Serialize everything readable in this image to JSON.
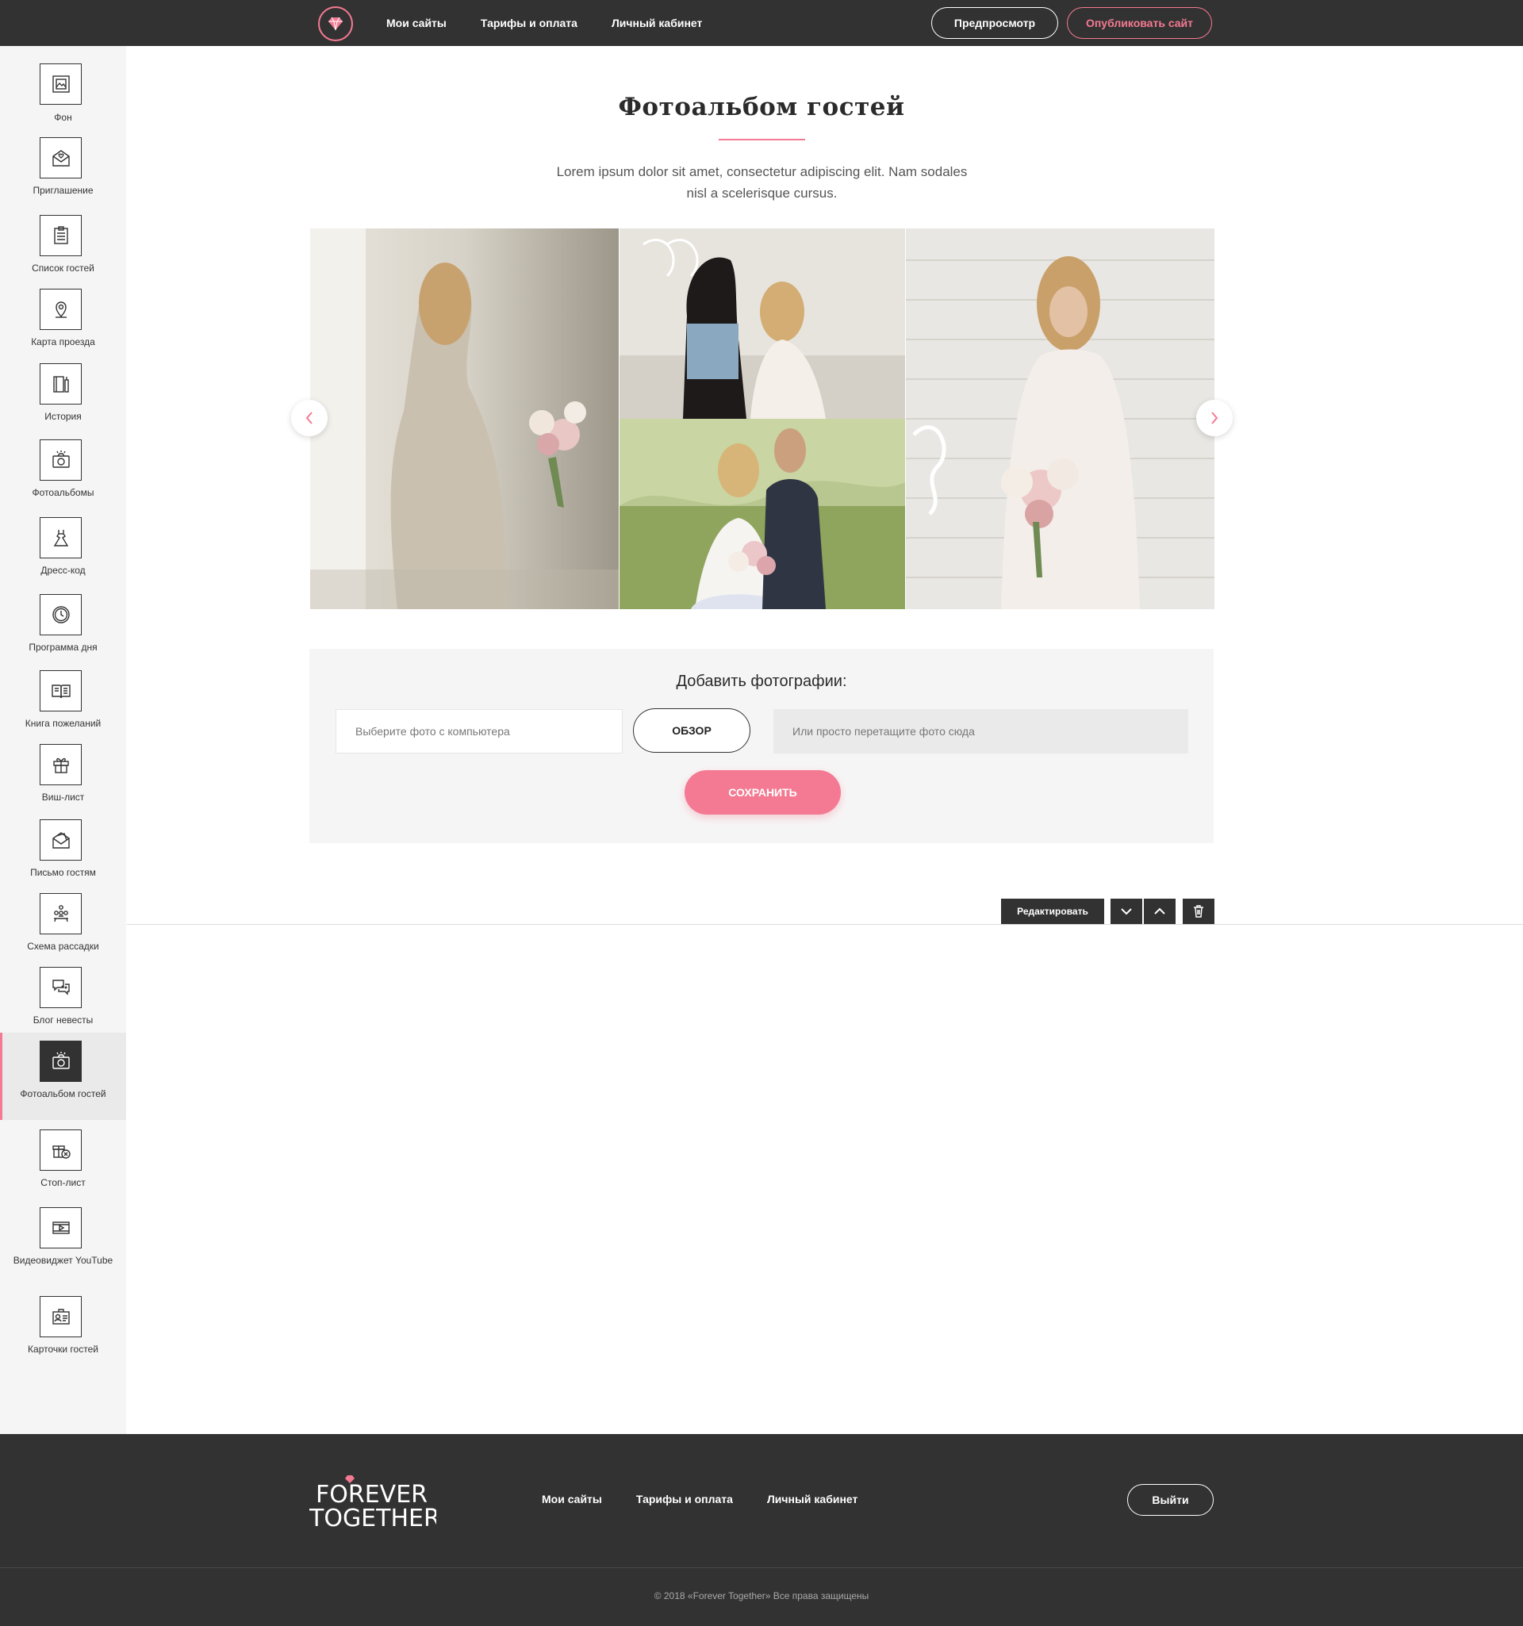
{
  "header": {
    "nav": [
      "Мои сайты",
      "Тарифы и оплата",
      "Личный кабинет"
    ],
    "preview_label": "Предпросмотр",
    "publish_label": "Опубликовать сайт",
    "accent_color": "#f47a93"
  },
  "sidebar": {
    "items": [
      {
        "label": "Фон",
        "icon": "background-image-icon"
      },
      {
        "label": "Приглашение",
        "icon": "invitation-envelope-icon"
      },
      {
        "label": "Список гостей",
        "icon": "guest-list-icon"
      },
      {
        "label": "Карта проезда",
        "icon": "map-pin-icon"
      },
      {
        "label": "История",
        "icon": "history-book-icon"
      },
      {
        "label": "Фотоальбомы",
        "icon": "camera-icon"
      },
      {
        "label": "Дресс-код",
        "icon": "dress-icon"
      },
      {
        "label": "Программа дня",
        "icon": "clock-icon"
      },
      {
        "label": "Книга пожеланий",
        "icon": "wish-book-icon"
      },
      {
        "label": "Виш-лист",
        "icon": "gift-icon"
      },
      {
        "label": "Письмо гостям",
        "icon": "letter-icon"
      },
      {
        "label": "Схема рассадки",
        "icon": "seating-icon"
      },
      {
        "label": "Блог невесты",
        "icon": "chat-icon"
      },
      {
        "label": "Фотоальбом гостей",
        "icon": "camera-icon",
        "active": true
      },
      {
        "label": "Стоп-лист",
        "icon": "stop-gift-icon"
      },
      {
        "label": "Видеовиджет YouTube",
        "icon": "video-icon"
      },
      {
        "label": "Карточки гостей",
        "icon": "guest-card-icon"
      }
    ]
  },
  "section": {
    "title": "Фотоальбом гостей",
    "subtitle": "Lorem ipsum dolor sit amet, consectetur adipiscing elit. Nam sodales nisl a scelerisque cursus."
  },
  "upload": {
    "title": "Добавить фотографии:",
    "file_placeholder": "Выберите фото с компьютера",
    "browse_label": "ОБЗОР",
    "drop_placeholder": "Или просто перетащите фото сюда",
    "save_label": "СОХРАНИТЬ"
  },
  "edit_bar": {
    "edit_label": "Редактировать"
  },
  "footer": {
    "nav": [
      "Мои сайты",
      "Тарифы и оплата",
      "Личный кабинет"
    ],
    "logout_label": "Выйти",
    "logo_line1": "FOREVER",
    "logo_line2": "TOGETHER",
    "copyright": "© 2018 «Forever Together» Все права защищены"
  }
}
